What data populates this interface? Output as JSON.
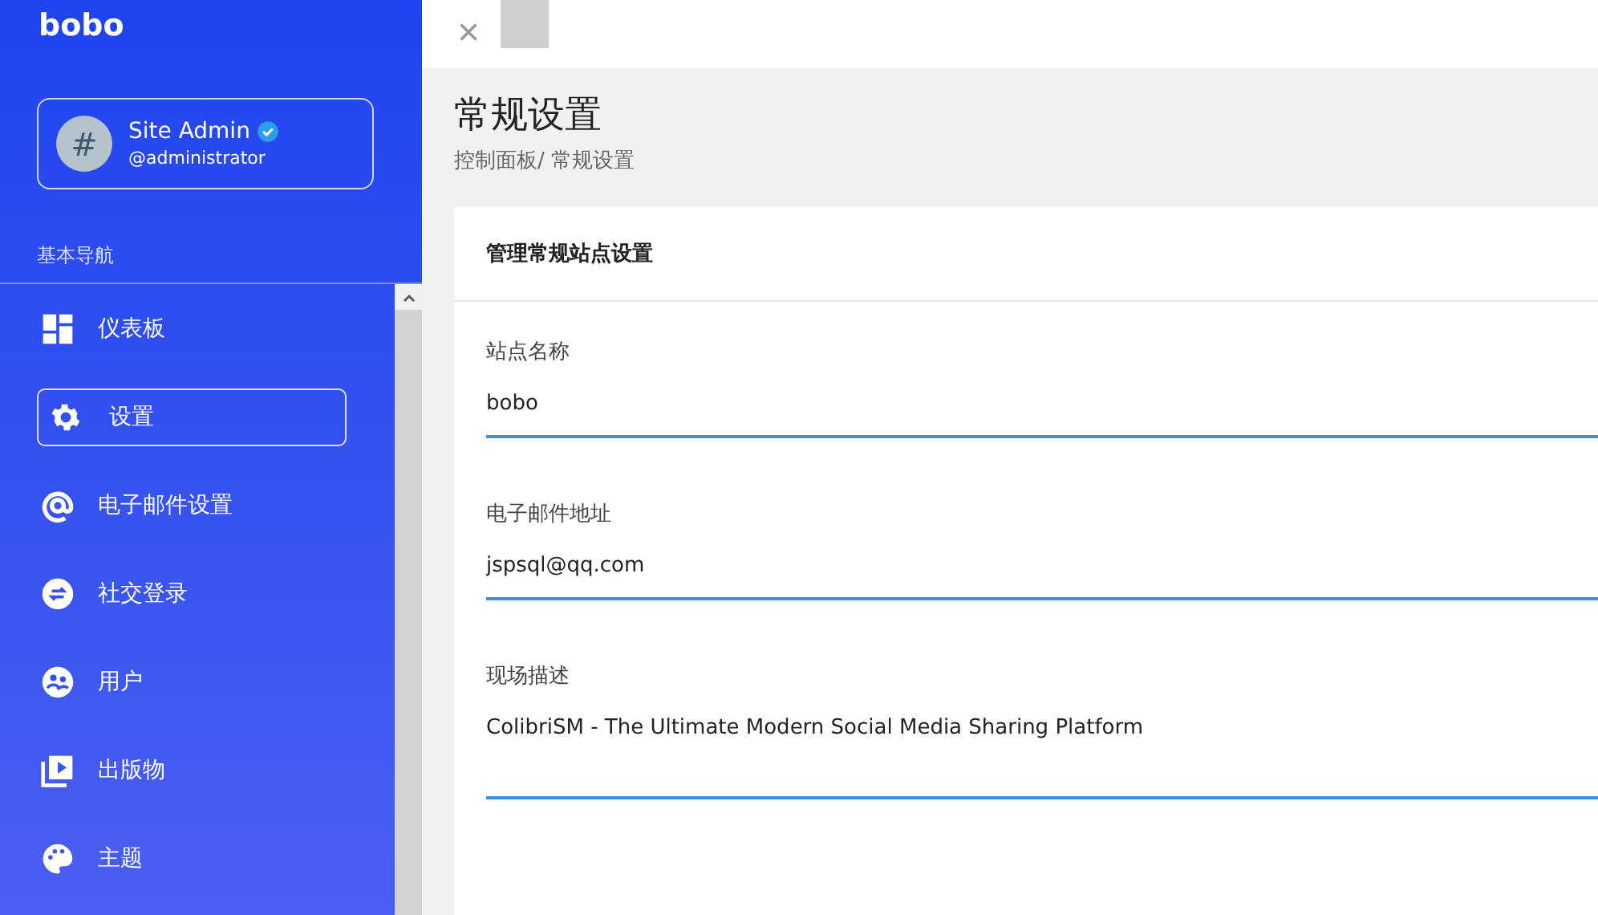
{
  "sidebar": {
    "brand": "bobo",
    "profile": {
      "avatar_text": "#",
      "name": "Site Admin",
      "verified": true,
      "handle": "@administrator"
    },
    "section_title": "基本导航",
    "items": [
      {
        "kind": "dashboard",
        "label": "仪表板",
        "selected": false
      },
      {
        "kind": "settings",
        "label": "设置",
        "selected": true
      },
      {
        "kind": "email",
        "label": "电子邮件设置",
        "selected": false
      },
      {
        "kind": "social",
        "label": "社交登录",
        "selected": false
      },
      {
        "kind": "users",
        "label": "用户",
        "selected": false
      },
      {
        "kind": "publications",
        "label": "出版物",
        "selected": false
      },
      {
        "kind": "themes",
        "label": "主题",
        "selected": false
      }
    ]
  },
  "topbar": {
    "close": "×"
  },
  "page": {
    "title": "常规设置",
    "breadcrumb": "控制面板/ 常规设置"
  },
  "card": {
    "title": "管理常规站点设置",
    "fields": [
      {
        "kind": "input",
        "label": "站点名称",
        "value": "bobo"
      },
      {
        "kind": "input",
        "label": "电子邮件地址",
        "value": "jspsql@qq.com"
      },
      {
        "kind": "textarea",
        "label": "现场描述",
        "value": "ColibriSM - The Ultimate Modern Social Media Sharing Platform"
      }
    ]
  }
}
